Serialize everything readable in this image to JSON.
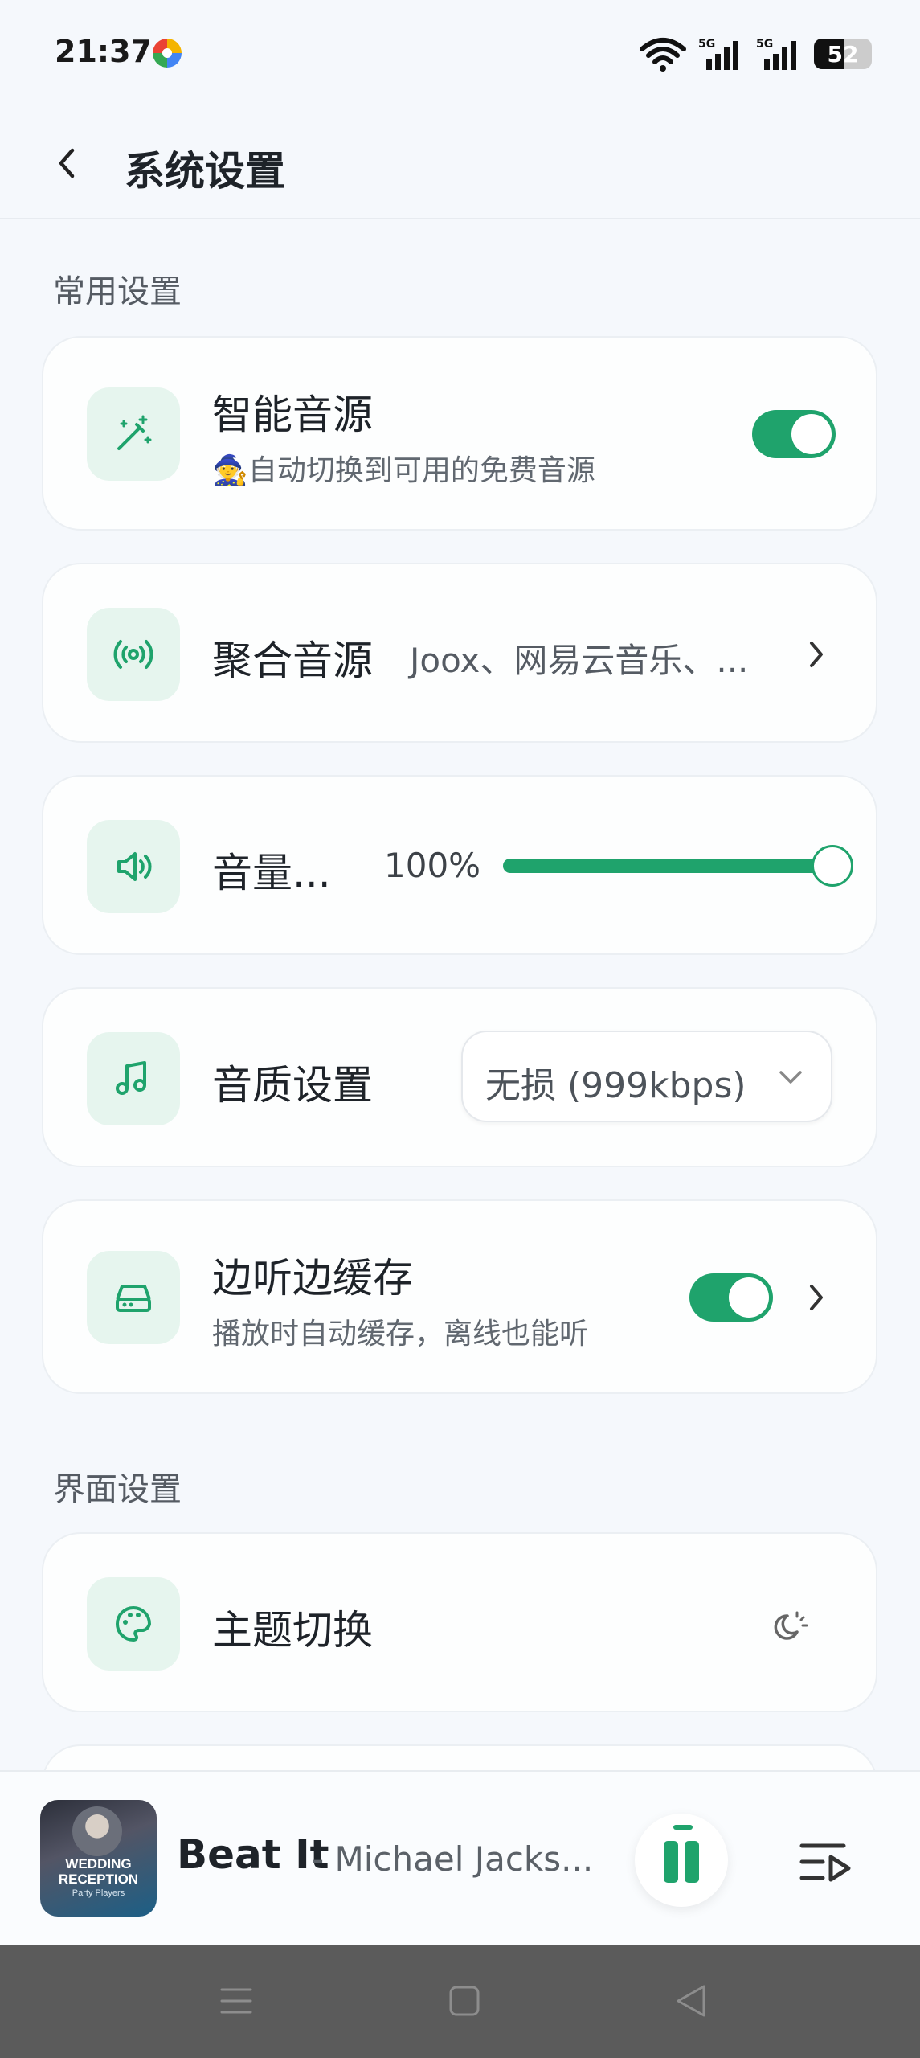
{
  "status_bar": {
    "time": "21:37",
    "battery": "52",
    "icons": [
      "app-icon",
      "wifi-icon",
      "signal-5g-icon",
      "signal-5g-icon",
      "battery-icon"
    ]
  },
  "header": {
    "title": "系统设置",
    "back_icon": "chevron-left-icon"
  },
  "sections": {
    "common": "常用设置",
    "interface": "界面设置"
  },
  "settings": {
    "smart_source": {
      "title": "智能音源",
      "subtitle": "🧙自动切换到可用的免费音源",
      "icon": "magic-wand-icon",
      "enabled": true
    },
    "aggregate_source": {
      "title": "聚合音源",
      "value": "Joox、网易云音乐、...",
      "icon": "broadcast-icon"
    },
    "volume": {
      "title": "音量...",
      "value_label": "100%",
      "level": 1.0,
      "icon": "speaker-icon"
    },
    "quality": {
      "title": "音质设置",
      "selected": "无损 (999kbps)",
      "icon": "music-note-icon"
    },
    "cache": {
      "title": "边听边缓存",
      "subtitle": "播放时自动缓存，离线也能听",
      "icon": "hard-drive-icon",
      "enabled": true
    },
    "theme": {
      "title": "主题切换",
      "icon": "palette-icon",
      "mode_icon": "moon-sun-icon"
    }
  },
  "player": {
    "song": "Beat It",
    "artist": "- Michael Jacks...",
    "album_text_1": "WEDDING RECEPTION",
    "album_text_2": "Party Players",
    "state": "playing"
  },
  "accent_color": "#1fa36c"
}
